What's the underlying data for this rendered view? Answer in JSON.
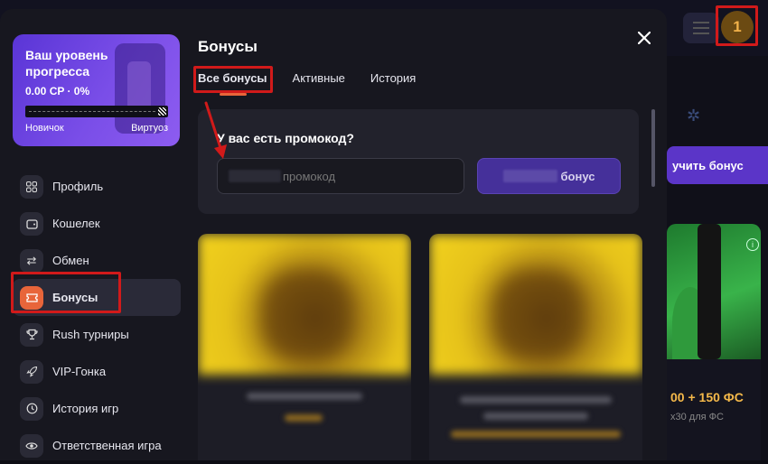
{
  "background": {
    "avatar_badge": "1",
    "bonus_button_label": "учить бонус",
    "card_value": "00 + 150 ФС",
    "card_sub": "х30 для ФС"
  },
  "progress": {
    "title": "Ваш уровень прогресса",
    "value": "0.00 CP · 0%",
    "level_min": "Новичок",
    "level_max": "Виртуоз",
    "percent": 0
  },
  "nav": {
    "items": [
      {
        "label": "Профиль",
        "icon": "grid-icon"
      },
      {
        "label": "Кошелек",
        "icon": "wallet-icon"
      },
      {
        "label": "Обмен",
        "icon": "exchange-icon"
      },
      {
        "label": "Бонусы",
        "icon": "ticket-icon"
      },
      {
        "label": "Rush турниры",
        "icon": "trophy-icon"
      },
      {
        "label": "VIP-Гонка",
        "icon": "rocket-icon"
      },
      {
        "label": "История игр",
        "icon": "clock-icon"
      },
      {
        "label": "Ответственная игра",
        "icon": "eye-icon"
      }
    ],
    "active_index": 3
  },
  "content": {
    "title": "Бонусы",
    "tabs": [
      "Все бонусы",
      "Активные",
      "История"
    ],
    "active_tab": 0
  },
  "promo": {
    "label": "У вас есть промокод?",
    "input_placeholder": "промокод",
    "button_label": "бонус"
  },
  "colors": {
    "accent": "#e8653a",
    "primary": "#5b35c8",
    "highlight": "#d11a1a"
  }
}
